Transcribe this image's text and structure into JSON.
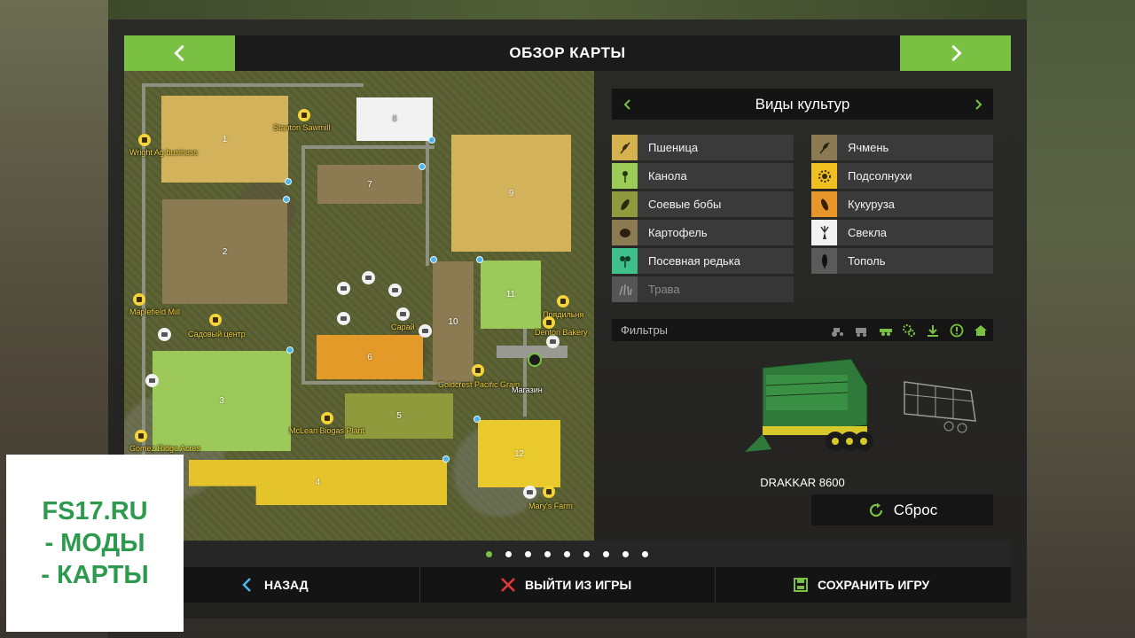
{
  "header": {
    "title": "ОБЗОР КАРТЫ"
  },
  "map": {
    "fields": [
      {
        "id": "1",
        "label": "1",
        "color": "#d3b25c"
      },
      {
        "id": "2",
        "label": "2",
        "color": "#8c7a53"
      },
      {
        "id": "3",
        "label": "3",
        "color": "#9cc95a"
      },
      {
        "id": "4",
        "label": "4",
        "color": "#e4c42a"
      },
      {
        "id": "5",
        "label": "5",
        "color": "#8f9a3c"
      },
      {
        "id": "6",
        "label": "6",
        "color": "#e49a28"
      },
      {
        "id": "7",
        "label": "7",
        "color": "#8c7a53"
      },
      {
        "id": "8",
        "label": "8",
        "color": "#f2f2f2"
      },
      {
        "id": "9",
        "label": "9",
        "color": "#d3b25c"
      },
      {
        "id": "10",
        "label": "10",
        "color": "#8c7a53"
      },
      {
        "id": "11",
        "label": "11",
        "color": "#9cc95a"
      },
      {
        "id": "12",
        "label": "12",
        "color": "#e9c92c"
      }
    ],
    "pois": [
      {
        "label": "Stanton Sawmill"
      },
      {
        "label": "Wright Ag business"
      },
      {
        "label": "Maplefield Mill"
      },
      {
        "label": "Садовый центр"
      },
      {
        "label": "Сарай"
      },
      {
        "label": "Прядильня"
      },
      {
        "label": "Denton Bakery"
      },
      {
        "label": "Goldcrest Pacific Grain"
      },
      {
        "label": "Магазин"
      },
      {
        "label": "McLean Biogas Plant"
      },
      {
        "label": "Gomez Ridge Acres"
      },
      {
        "label": "Mary's Farm"
      }
    ]
  },
  "crops": {
    "title": "Виды культур",
    "left": [
      {
        "label": "Пшеница",
        "icon": "wheat-icon",
        "color": "#d6b24e"
      },
      {
        "label": "Канола",
        "icon": "canola-icon",
        "color": "#9ccb58"
      },
      {
        "label": "Соевые бобы",
        "icon": "soybean-icon",
        "color": "#8f9a3c"
      },
      {
        "label": "Картофель",
        "icon": "potato-icon",
        "color": "#8c7a53"
      },
      {
        "label": "Посевная редька",
        "icon": "radish-icon",
        "color": "#3fbf8a"
      },
      {
        "label": "Трава",
        "icon": "grass-icon",
        "color": "#555555"
      }
    ],
    "right": [
      {
        "label": "Ячмень",
        "icon": "barley-icon",
        "color": "#8c7a53"
      },
      {
        "label": "Подсолнухи",
        "icon": "sunflower-icon",
        "color": "#f0c020"
      },
      {
        "label": "Кукуруза",
        "icon": "corn-icon",
        "color": "#e8962a"
      },
      {
        "label": "Свекла",
        "icon": "sugarbeet-icon",
        "color": "#f2f2f2"
      },
      {
        "label": "Тополь",
        "icon": "poplar-icon",
        "color": "#5a5a5a"
      }
    ]
  },
  "filters": {
    "label": "Фильтры",
    "buttons": [
      "tractor-icon",
      "harvester-icon",
      "trailer-icon",
      "tools-icon",
      "download-icon",
      "warning-icon",
      "home-icon"
    ]
  },
  "vehicle": {
    "name": "DRAKKAR 8600"
  },
  "reset": {
    "label": "Сброс"
  },
  "pagination": {
    "count": 9,
    "active": 0
  },
  "bottom": {
    "back": "НАЗАД",
    "quit": "ВЫЙТИ ИЗ ИГРЫ",
    "save": "СОХРАНИТЬ ИГРУ"
  },
  "watermark": {
    "line1": "FS17.RU",
    "line2": "- МОДЫ",
    "line3": "- КАРТЫ"
  },
  "colors": {
    "accent": "#7ac143",
    "poi": "#f4d43a",
    "danger": "#e53935"
  }
}
